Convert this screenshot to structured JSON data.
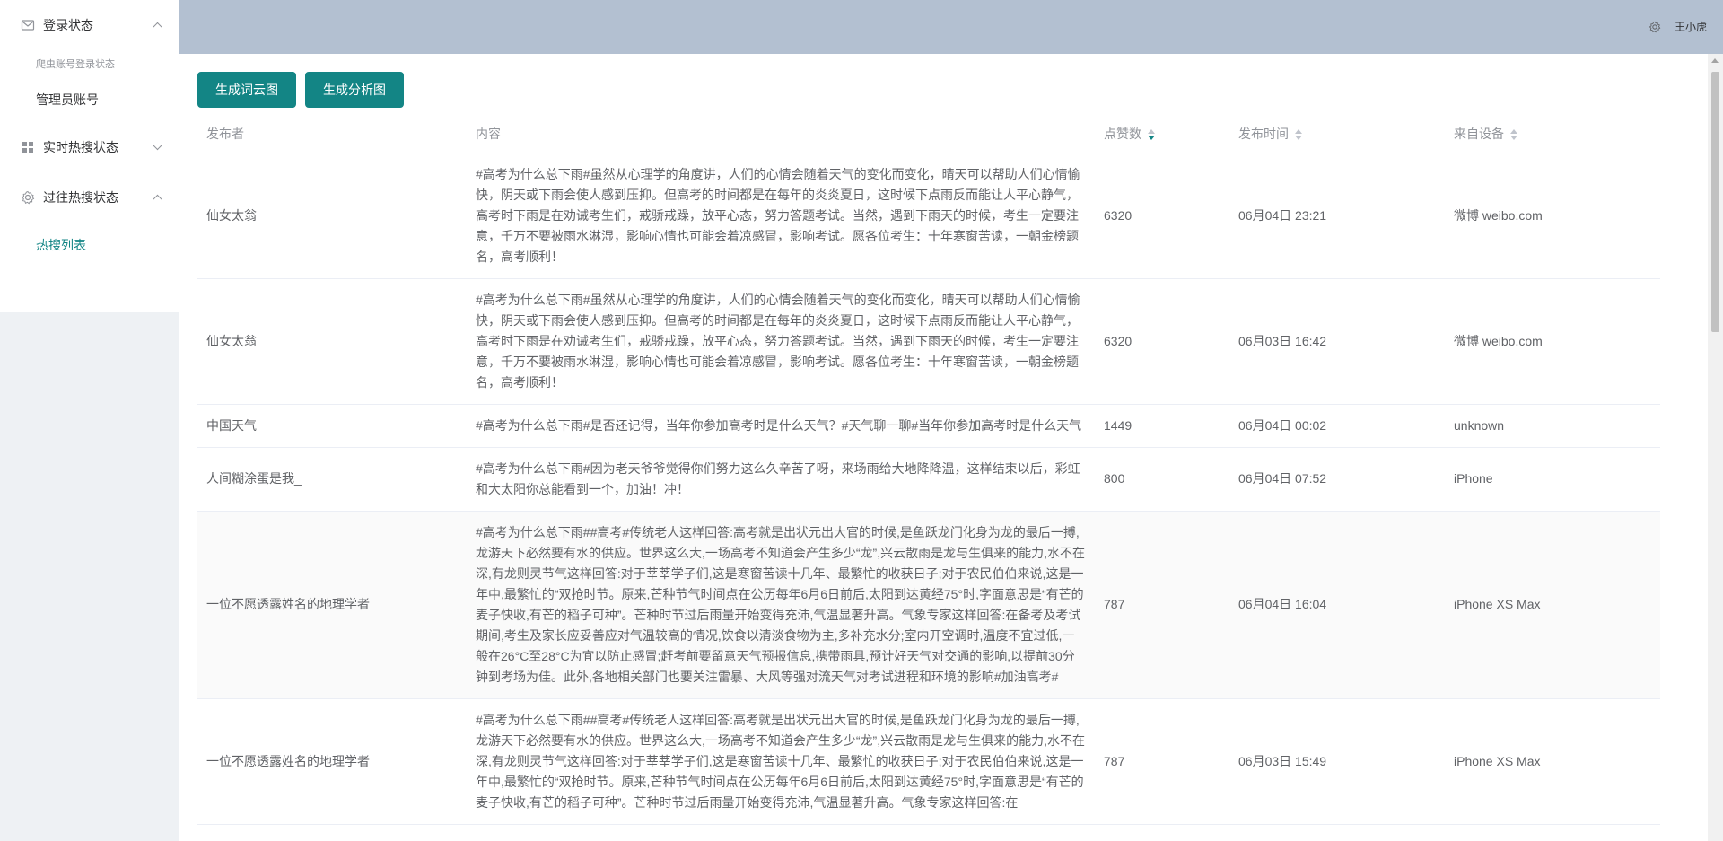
{
  "sidebar": {
    "menus": [
      {
        "title": "登录状态",
        "icon": "mail-icon",
        "expanded": true,
        "group_label": "爬虫账号登录状态",
        "items": [
          {
            "label": "管理员账号",
            "active": false
          }
        ]
      },
      {
        "title": "实时热搜状态",
        "icon": "grid-icon",
        "expanded": false
      },
      {
        "title": "过往热搜状态",
        "icon": "gear-icon",
        "expanded": true,
        "items": [
          {
            "label": "热搜列表",
            "active": true
          }
        ]
      }
    ]
  },
  "header": {
    "username": "王小虎",
    "settings_icon": "gear-icon"
  },
  "toolbar": {
    "wordcloud_label": "生成词云图",
    "analysis_label": "生成分析图"
  },
  "table": {
    "columns": {
      "author": "发布者",
      "content": "内容",
      "likes": "点赞数",
      "time": "发布时间",
      "device": "来自设备"
    },
    "sort": {
      "column": "likes",
      "order": "desc"
    },
    "rows": [
      {
        "author": "仙女太翁",
        "content": "#高考为什么总下雨#虽然从心理学的角度讲，人们的心情会随着天气的变化而变化，晴天可以帮助人们心情愉快，阴天或下雨会使人感到压抑。但高考的时间都是在每年的炎炎夏日，这时候下点雨反而能让人平心静气，高考时下雨是在劝诫考生们，戒骄戒躁，放平心态，努力答题考试。当然，遇到下雨天的时候，考生一定要注意，千万不要被雨水淋湿，影响心情也可能会着凉感冒，影响考试。愿各位考生：十年寒窗苦读，一朝金榜题名，高考顺利！",
        "likes": "6320",
        "time": "06月04日 23:21",
        "device": "微博 weibo.com"
      },
      {
        "author": "仙女太翁",
        "content": "#高考为什么总下雨#虽然从心理学的角度讲，人们的心情会随着天气的变化而变化，晴天可以帮助人们心情愉快，阴天或下雨会使人感到压抑。但高考的时间都是在每年的炎炎夏日，这时候下点雨反而能让人平心静气，高考时下雨是在劝诫考生们，戒骄戒躁，放平心态，努力答题考试。当然，遇到下雨天的时候，考生一定要注意，千万不要被雨水淋湿，影响心情也可能会着凉感冒，影响考试。愿各位考生：十年寒窗苦读，一朝金榜题名，高考顺利！",
        "likes": "6320",
        "time": "06月03日 16:42",
        "device": "微博 weibo.com"
      },
      {
        "author": "中国天气",
        "content": "#高考为什么总下雨#是否还记得，当年你参加高考时是什么天气？#天气聊一聊#当年你参加高考时是什么天气",
        "likes": "1449",
        "time": "06月04日 00:02",
        "device": "unknown"
      },
      {
        "author": "人间糊涂蛋是我_",
        "content": "#高考为什么总下雨#因为老天爷爷觉得你们努力这么久辛苦了呀，来场雨给大地降降温，这样结束以后，彩虹和大太阳你总能看到一个，加油！冲！",
        "likes": "800",
        "time": "06月04日 07:52",
        "device": "iPhone"
      },
      {
        "author": "一位不愿透露姓名的地理学者",
        "content": "#高考为什么总下雨##高考#传统老人这样回答:高考就是出状元出大官的时候,是鱼跃龙门化身为龙的最后一搏,龙游天下必然要有水的供应。世界这么大,一场高考不知道会产生多少“龙”,兴云散雨是龙与生俱来的能力,水不在深,有龙则灵节气这样回答:对于莘莘学子们,这是寒窗苦读十几年、最繁忙的收获日子;对于农民伯伯来说,这是一年中,最繁忙的“双抢时节。原来,芒种节气时间点在公历每年6月6日前后,太阳到达黄经75°时,字面意思是“有芒的麦子快收,有芒的稻子可种”。芒种时节过后雨量开始变得充沛,气温显著升高。气象专家这样回答:在备考及考试期间,考生及家长应妥善应对气温较高的情况,饮食以清淡食物为主,多补充水分;室内开空调时,温度不宜过低,一般在26°C至28°C为宜以防止感冒;赶考前要留意天气预报信息,携带雨具,预计好天气对交通的影响,以提前30分钟到考场为佳。此外,各地相关部门也要关注雷暴、大风等强对流天气对考试进程和环境的影响#加油高考#",
        "likes": "787",
        "time": "06月04日 16:04",
        "device": "iPhone XS Max"
      },
      {
        "author": "一位不愿透露姓名的地理学者",
        "content": "#高考为什么总下雨##高考#传统老人这样回答:高考就是出状元出大官的时候,是鱼跃龙门化身为龙的最后一搏,龙游天下必然要有水的供应。世界这么大,一场高考不知道会产生多少“龙”,兴云散雨是龙与生俱来的能力,水不在深,有龙则灵节气这样回答:对于莘莘学子们,这是寒窗苦读十几年、最繁忙的收获日子;对于农民伯伯来说,这是一年中,最繁忙的“双抢时节。原来,芒种节气时间点在公历每年6月6日前后,太阳到达黄经75°时,字面意思是“有芒的麦子快收,有芒的稻子可种”。芒种时节过后雨量开始变得充沛,气温显著升高。气象专家这样回答:在",
        "likes": "787",
        "time": "06月03日 15:49",
        "device": "iPhone XS Max"
      }
    ]
  }
}
